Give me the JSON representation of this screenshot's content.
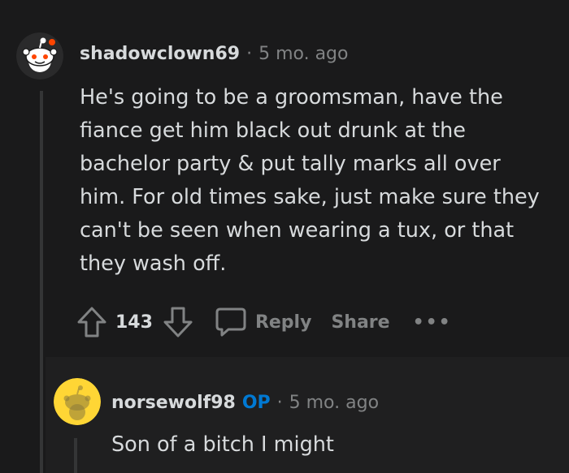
{
  "comment": {
    "username": "shadowclown69",
    "separator": "·",
    "time": "5 mo. ago",
    "body_lines": [
      "He's going to be a groomsman, have the",
      "fiance get him black out drunk at the",
      "bachelor party & put tally marks all over",
      "him. For old times sake, just make sure they",
      "can't be seen when wearing a tux, or that",
      "they wash off."
    ],
    "score": "143",
    "reply_label": "Reply",
    "share_label": "Share",
    "more_label": "•••",
    "avatar_icon": "snoo-avatar-white"
  },
  "reply": {
    "username": "norsewolf98",
    "op_badge": "OP",
    "separator": "·",
    "time": "5 mo. ago",
    "body": "Son of a bitch I might",
    "avatar_icon": "snoo-avatar-yellow"
  },
  "colors": {
    "background": "#1a1a1b",
    "reply_background": "#1f1f20",
    "text": "#d7dadc",
    "muted": "#818384",
    "op_blue": "#0079d3",
    "snoo_red": "#ff4500",
    "avatar_yellow": "#ffd635"
  }
}
